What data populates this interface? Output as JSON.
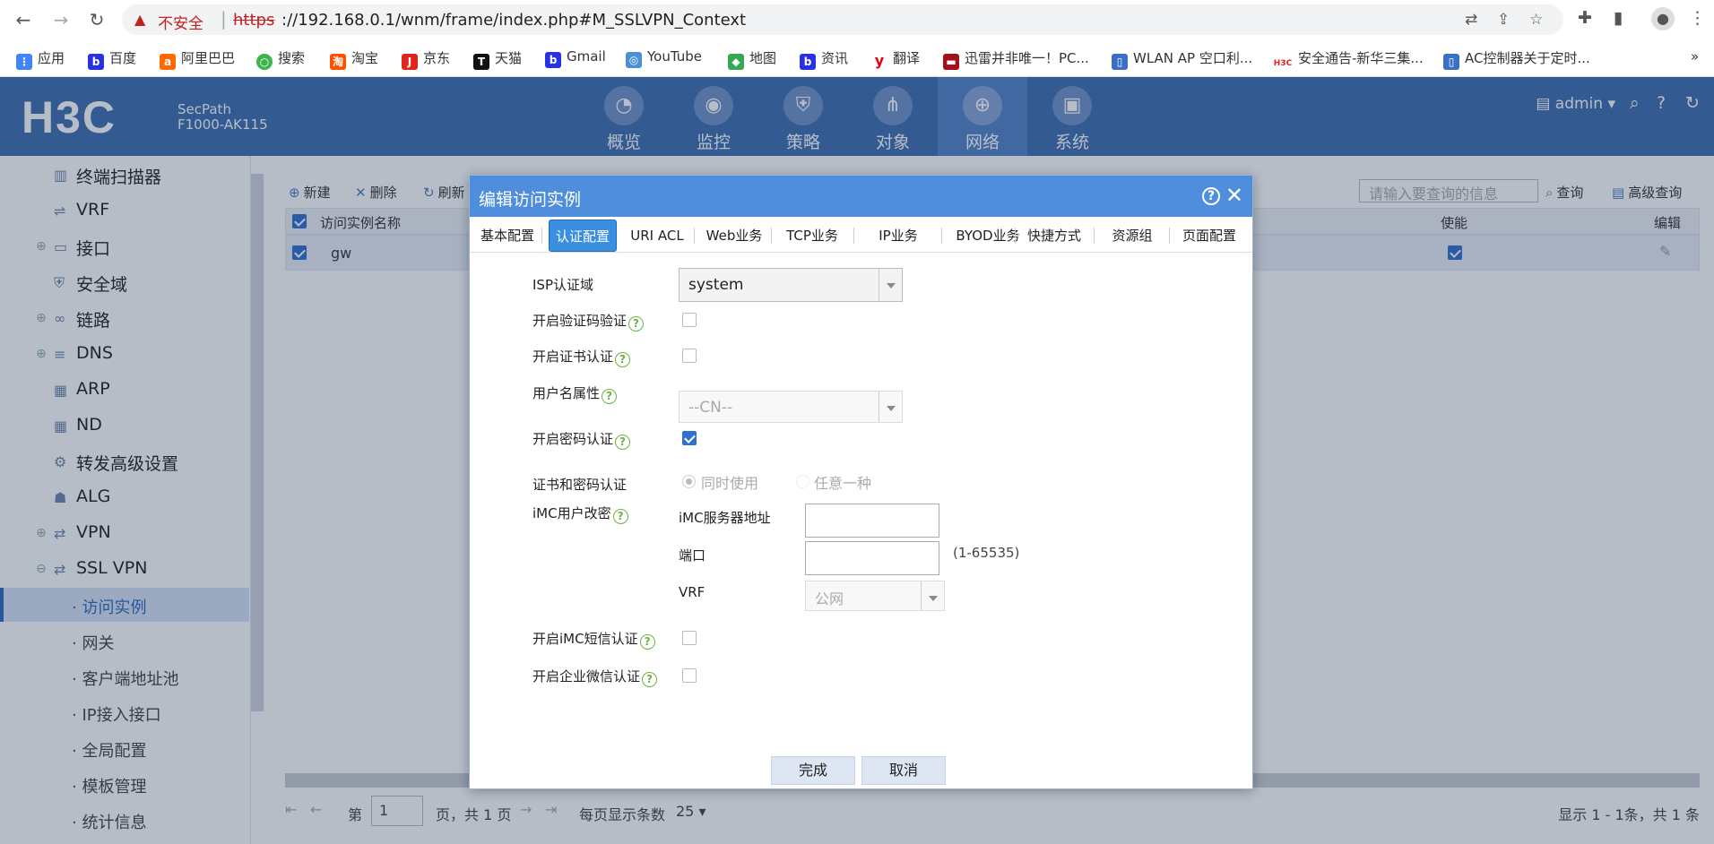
{
  "browser": {
    "insecure_label": "不安全",
    "url_proto": "https",
    "url_rest": "://192.168.0.1/wnm/frame/index.php#M_SSLVPN_Context",
    "bookmarks": [
      "应用",
      "百度",
      "阿里巴巴",
      "搜索",
      "淘宝",
      "京东",
      "天猫",
      "Gmail",
      "YouTube",
      "地图",
      "资讯",
      "翻译",
      "迅雷并非唯一！PC...",
      "WLAN AP 空口利...",
      "安全通告-新华三集...",
      "AC控制器关于定时..."
    ],
    "bookmark_more": "»"
  },
  "header": {
    "logo": "H3C",
    "product_line1": "SecPath",
    "product_line2": "F1000-AK115",
    "modules": [
      "概览",
      "监控",
      "策略",
      "对象",
      "网络",
      "系统"
    ],
    "active_module": 4,
    "user": "admin"
  },
  "sidebar": {
    "items": [
      "终端扫描器",
      "VRF",
      "接口",
      "安全域",
      "链路",
      "DNS",
      "ARP",
      "ND",
      "转发高级设置",
      "ALG",
      "VPN",
      "SSL VPN"
    ],
    "subitems": [
      "访问实例",
      "网关",
      "客户端地址池",
      "IP接入接口",
      "全局配置",
      "模板管理",
      "统计信息"
    ]
  },
  "main": {
    "toolbar": {
      "new": "新建",
      "delete": "删除",
      "refresh": "刷新",
      "search_placeholder": "请输入要查询的信息",
      "search": "查询",
      "adv_search": "高级查询"
    },
    "columns": {
      "name": "访问实例名称",
      "enable": "使能",
      "edit": "编辑"
    },
    "row": {
      "name": "gw"
    },
    "pager": {
      "page_prefix": "第",
      "page": "1",
      "page_suffix": "页，共 1 页",
      "per_page_label": "每页显示条数",
      "per_page": "25",
      "summary": "显示 1 - 1条，共 1 条"
    }
  },
  "dialog": {
    "title": "编辑访问实例",
    "tabs": [
      "基本配置",
      "认证配置",
      "URI ACL",
      "Web业务",
      "TCP业务",
      "IP业务",
      "BYOD业务",
      "快捷方式",
      "资源组",
      "页面配置"
    ],
    "active_tab": 1,
    "fields": {
      "isp_label": "ISP认证域",
      "isp_value": "system",
      "captcha_label": "开启验证码验证",
      "cert_label": "开启证书认证",
      "username_attr_label": "用户名属性",
      "username_attr_value": "--CN--",
      "pwd_label": "开启密码认证",
      "cert_pwd_label": "证书和密码认证",
      "cert_pwd_opt1": "同时使用",
      "cert_pwd_opt2": "任意一种",
      "imc_label": "iMC用户改密",
      "imc_server_label": "iMC服务器地址",
      "port_label": "端口",
      "port_hint": "(1-65535)",
      "vrf_label": "VRF",
      "vrf_value": "公网",
      "imc_sms_label": "开启iMC短信认证",
      "wechat_label": "开启企业微信认证"
    },
    "ok": "完成",
    "cancel": "取消"
  }
}
